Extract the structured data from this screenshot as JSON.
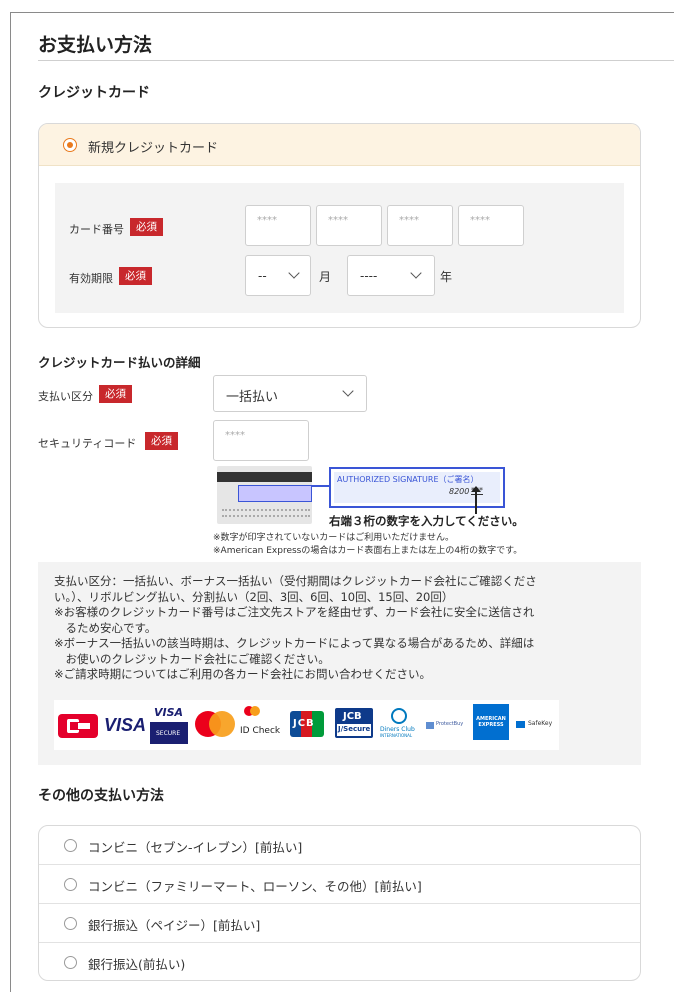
{
  "title": "お支払い方法",
  "credit_section": {
    "heading": "クレジットカード",
    "new_card_label": "新規クレジットカード",
    "card_number_label": "カード番号",
    "expiry_label": "有効期限",
    "required_badge": "必須",
    "card_placeholders": [
      "****",
      "****",
      "****",
      "****"
    ],
    "month_value": "--",
    "month_suffix": "月",
    "year_value": "----",
    "year_suffix": "年"
  },
  "details_section": {
    "heading": "クレジットカード払いの詳細",
    "payment_type_label": "支払い区分",
    "payment_type_value": "一括払い",
    "security_label": "セキュリティコード",
    "security_placeholder": "****",
    "signature_label": "AUTHORIZED SIGNATURE（ご署名）",
    "signature_number": "8200",
    "signature_digits": "***",
    "instruction": "右端３桁の数字を入力してください。",
    "note1": "※数字が印字されていないカードはご利用いただけません。",
    "note2": "※American Expressの場合はカード表面右上または左上の4桁の数字です。"
  },
  "notice": {
    "lines": [
      "支払い区分：一括払い、ボーナス一括払い（受付期間はクレジットカード会社にご確認くださ",
      "い。）、リボルビング払い、分割払い（2回、3回、6回、10回、15回、20回）",
      "※お客様のクレジットカード番号はご注文先ストアを経由せず、カード会社に安全に送信され",
      "　るため安心です。",
      "※ボーナス一括払いの該当時期は、クレジットカードによって異なる場合があるため、詳細は",
      "　お使いのクレジットカード会社にご確認ください。",
      "※ご請求時期についてはご利用の各カード会社にお問い合わせください。"
    ],
    "brands": {
      "visa": "VISA",
      "visa_secure": "VISA",
      "visa_secure_sub": "SECURE",
      "id_check": "ID Check",
      "jcb": "JCB",
      "jsecure": "JCB",
      "jsecure_sub": "J/Secure",
      "diners": "Diners Club",
      "diners_sub": "INTERNATIONAL",
      "protectbuy": "ProtectBuy",
      "amex": "AMERICAN EXPRESS",
      "safekey": "SafeKey"
    }
  },
  "other_section": {
    "heading": "その他の支払い方法",
    "options": [
      "コンビニ（セブン-イレブン）[前払い]",
      "コンビニ（ファミリーマート、ローソン、その他）[前払い]",
      "銀行振込（ペイジー）[前払い]",
      "銀行振込(前払い)"
    ]
  },
  "colors": {
    "accent_orange": "#e97a1d",
    "required_red": "#c8282c",
    "card_header_bg": "#fdf3e2",
    "panel_bg": "#f3f3f3",
    "highlight_blue": "#3a55d6"
  }
}
